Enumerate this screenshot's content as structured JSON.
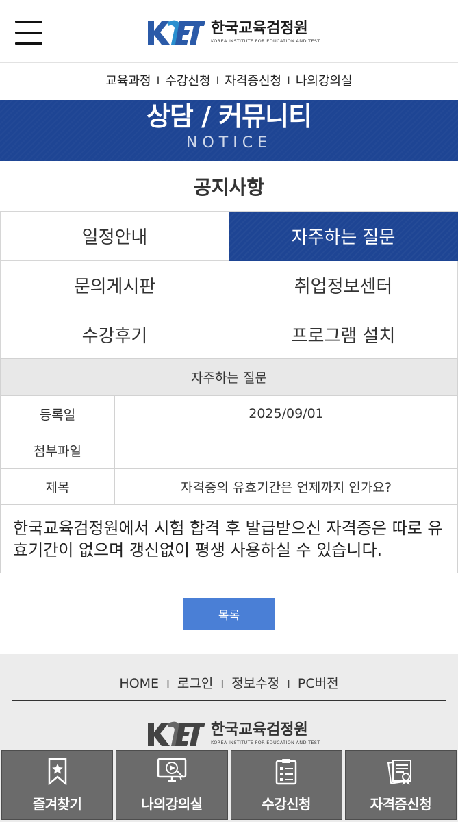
{
  "header": {
    "logo_kr": "한국교육검정원",
    "logo_en": "KOREA INSTITUTE FOR EDUCATION AND TEST",
    "logo_mark": "KIET"
  },
  "quicknav": [
    "교육과정",
    "수강신청",
    "자격증신청",
    "나의강의실"
  ],
  "banner": {
    "title": "상담 / 커뮤니티",
    "subtitle": "NOTICE"
  },
  "section_title": "공지사항",
  "menu": [
    {
      "label": "일정안내",
      "active": false
    },
    {
      "label": "자주하는 질문",
      "active": true
    },
    {
      "label": "문의게시판",
      "active": false
    },
    {
      "label": "취업정보센터",
      "active": false
    },
    {
      "label": "수강후기",
      "active": false
    },
    {
      "label": "프로그램 설치",
      "active": false
    }
  ],
  "board": {
    "heading": "자주하는 질문",
    "rows": [
      {
        "label": "등록일",
        "value": "2025/09/01"
      },
      {
        "label": "첨부파일",
        "value": ""
      },
      {
        "label": "제목",
        "value": "자격증의 유효기간은 언제까지 인가요?"
      }
    ],
    "body": "한국교육검정원에서 시험 합격 후 발급받으신 자격증은 따로 유효기간이 없으며 갱신없이 평생 사용하실 수 있습니다."
  },
  "list_button": "목록",
  "footer": {
    "links": [
      "HOME",
      "로그인",
      "정보수정",
      "PC버전"
    ]
  },
  "tabbar": [
    {
      "label": "즐겨찾기",
      "icon": "bookmark-star-icon"
    },
    {
      "label": "나의강의실",
      "icon": "monitor-play-icon"
    },
    {
      "label": "수강신청",
      "icon": "clipboard-list-icon"
    },
    {
      "label": "자격증신청",
      "icon": "certificate-icon"
    }
  ],
  "colors": {
    "primary": "#1e4594",
    "button": "#4a7fd6",
    "tab": "#6b6b6b",
    "footer": "#ececec"
  }
}
